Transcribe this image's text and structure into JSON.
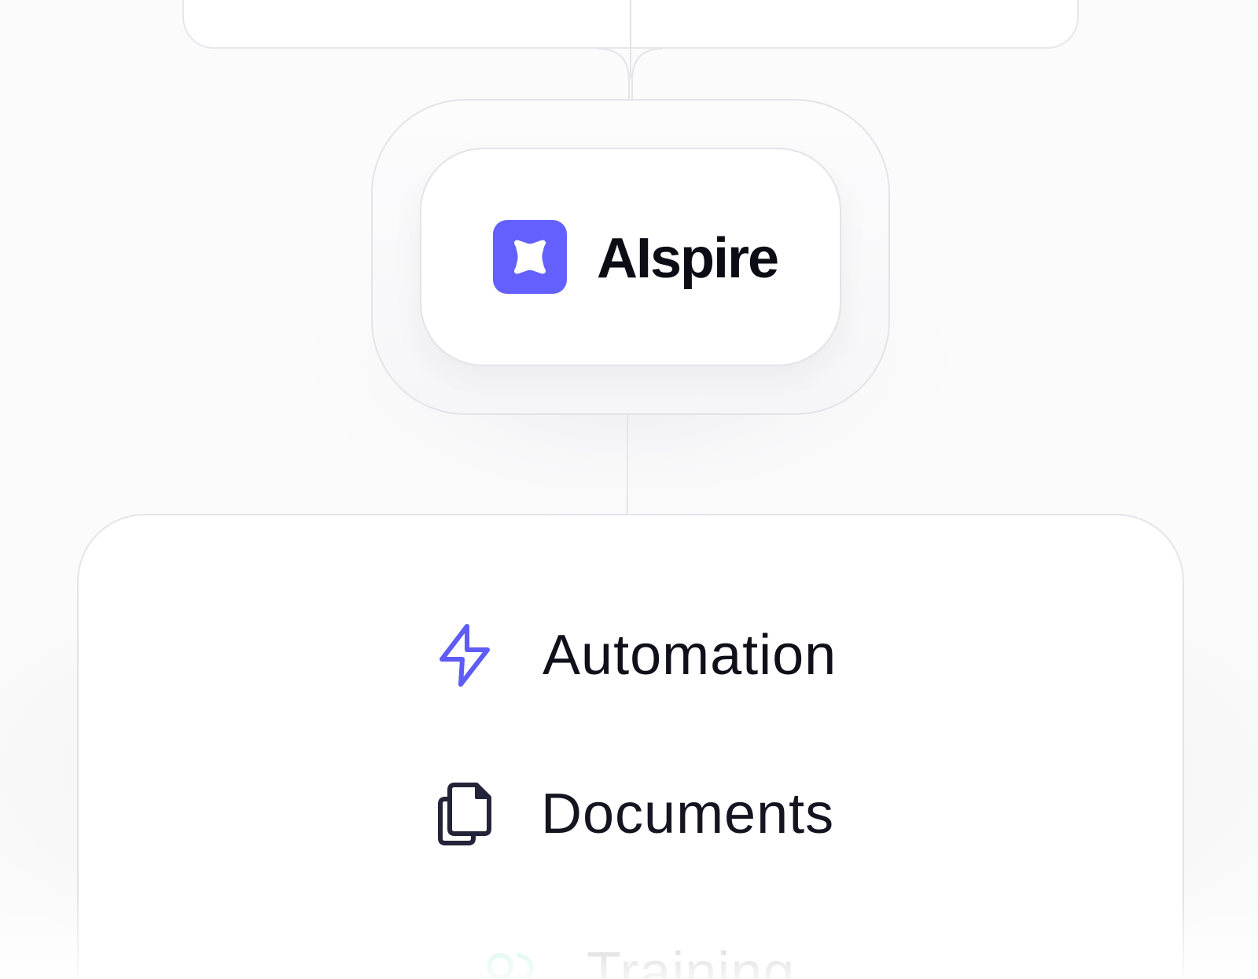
{
  "colors": {
    "brand": "#6460ff",
    "automation_icon": "#5f5bf5",
    "documents_icon": "#23233a",
    "training_icon": "#34d3a4",
    "line": "#e4e4ea"
  },
  "central_node": {
    "logo_icon": "sparkle-icon",
    "brand_name": "AIspire"
  },
  "features": [
    {
      "label": "Automation",
      "icon": "lightning-bolt-icon"
    },
    {
      "label": "Documents",
      "icon": "documents-icon"
    },
    {
      "label": "Training",
      "icon": "training-icon"
    }
  ]
}
